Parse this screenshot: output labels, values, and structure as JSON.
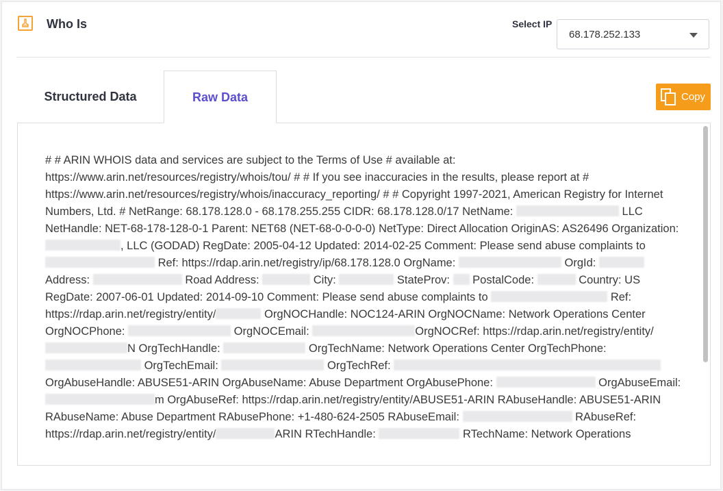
{
  "header": {
    "title": "Who Is",
    "select_label": "Select IP",
    "selected_ip": "68.178.252.133"
  },
  "tabs": [
    {
      "label": "Structured Data",
      "active": false
    },
    {
      "label": "Raw Data",
      "active": true
    }
  ],
  "copy_button": {
    "label": "Copy"
  },
  "icons": {
    "title": "brush-icon",
    "select": "chevron-down-icon",
    "copy": "copy-icon"
  },
  "colors": {
    "accent": "#f59c1a",
    "active_tab": "#5b4fd0"
  },
  "raw": {
    "p1": "# # ARIN WHOIS data and services are subject to the Terms of Use # available at: https://www.arin.net/resources/registry/whois/tou/ # # If you see inaccuracies in the results, please report at # https://www.arin.net/resources/registry/whois/inaccuracy_reporting/ # # Copyright 1997-2021, American Registry for Internet Numbers, Ltd. # NetRange: 68.178.128.0 - 68.178.255.255 CIDR: 68.178.128.0/17 NetName:",
    "p2": "LLC NetHandle: NET-68-178-128-0-1 Parent: NET68 (NET-68-0-0-0-0) NetType: Direct Allocation OriginAS: AS26496 Organization:",
    "p3": ", LLC (GODAD) RegDate: 2005-04-12 Updated: 2014-02-25 Comment: Please send abuse complaints to",
    "p4": "Ref: https://rdap.arin.net/registry/ip/68.178.128.0 OrgName:",
    "p5": "OrgId:",
    "p6": "Address:",
    "p7": "Road Address:",
    "p8": "City:",
    "p9": "StateProv:",
    "p10": "PostalCode:",
    "p11": "Country: US RegDate: 2007-06-01 Updated: 2014-09-10 Comment: Please send abuse complaints to",
    "p12": "Ref: https://rdap.arin.net/registry/entity/",
    "p13": "OrgNOCHandle: NOC124-ARIN OrgNOCName: Network Operations Center OrgNOCPhone:",
    "p14": "OrgNOCEmail:",
    "p15": "OrgNOCRef: https://rdap.arin.net/registry/entity/",
    "p16": "N OrgTechHandle:",
    "p17": "OrgTechName: Network Operations Center OrgTechPhone:",
    "p18": "OrgTechEmail:",
    "p19": "OrgTechRef:",
    "p20": "OrgAbuseHandle: ABUSE51-ARIN OrgAbuseName: Abuse Department OrgAbusePhone:",
    "p21": "OrgAbuseEmail:",
    "p22": "m OrgAbuseRef: https://rdap.arin.net/registry/entity/ABUSE51-ARIN RAbuseHandle: ABUSE51-ARIN RAbuseName: Abuse Department RAbusePhone: +1-480-624-2505 RAbuseEmail:",
    "p23": "RAbuseRef: https://rdap.arin.net/registry/entity/",
    "p24": "ARIN RTechHandle:",
    "p25": "RTechName: Network Operations"
  }
}
